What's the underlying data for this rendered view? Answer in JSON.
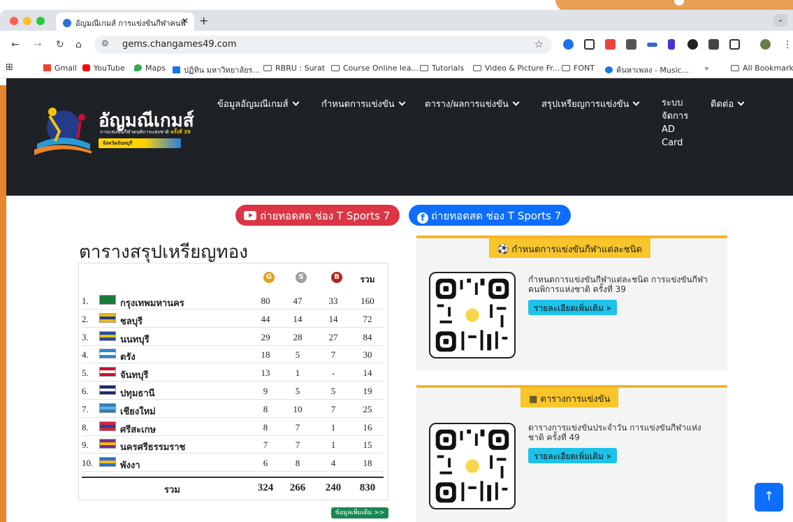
{
  "browser": {
    "tab_title": "อัญมณีเกมส์ การแข่งขันกีฬาคนพิ",
    "url": "gems.changames49.com",
    "bookmarks": [
      {
        "label": "Gmail",
        "icon": "gmail-icon"
      },
      {
        "label": "YouTube",
        "icon": "youtube-icon"
      },
      {
        "label": "Maps",
        "icon": "maps-icon"
      },
      {
        "label": "ปฏิทิน มหาวิทยาลัยร...",
        "icon": "calendar-icon"
      },
      {
        "label": "RBRU : Surat",
        "icon": "folder-icon"
      },
      {
        "label": "Course Online lea...",
        "icon": "folder-icon"
      },
      {
        "label": "Tutorials",
        "icon": "folder-icon"
      },
      {
        "label": "Video & Picture Fr...",
        "icon": "folder-icon"
      },
      {
        "label": "FONT",
        "icon": "folder-icon"
      },
      {
        "label": "ค้นหาเพลง - Music...",
        "icon": "music-icon"
      }
    ],
    "bookmarks_overflow": "»",
    "all_bookmarks": "All Bookmarks"
  },
  "site": {
    "logo_title": "อัญมณีเกมส์",
    "logo_sub": "การแข่งขันกีฬาคนพิการแห่งชาติ",
    "logo_sub_bold": "ครั้งที่ 39",
    "logo_ribbon": "จังหวัดจันทบุรี",
    "nav": [
      {
        "label": "ข้อมูลอัญมณีเกมส์"
      },
      {
        "label": "กำหนดการแข่งขัน"
      },
      {
        "label": "ตาราง/ผลการแข่งขัน"
      },
      {
        "label": "สรุปเหรียญการแข่งขัน"
      },
      {
        "label": "ติดต่อ"
      }
    ],
    "nav_ad": "ระบบ จัดการ AD Card"
  },
  "live": {
    "youtube": "ถ่ายทอดสด ช่อง T Sports 7",
    "facebook": "ถ่ายทอดสด ช่อง T Sports 7"
  },
  "medals": {
    "title": "ตารางสรุปเหรียญทอง",
    "head_g": "G",
    "head_s": "S",
    "head_b": "B",
    "head_total": "รวม",
    "rows": [
      {
        "rank": "1.",
        "name": "กรุงเทพมหานคร",
        "g": "80",
        "s": "47",
        "b": "33",
        "t": "160",
        "flag": [
          "#1a7a3a",
          "#1a7a3a"
        ]
      },
      {
        "rank": "2.",
        "name": "ชลบุรี",
        "g": "44",
        "s": "14",
        "b": "14",
        "t": "72",
        "flag": [
          "#f0b800",
          "#1d3e99"
        ]
      },
      {
        "rank": "3.",
        "name": "นนทบุรี",
        "g": "29",
        "s": "28",
        "b": "27",
        "t": "84",
        "flag": [
          "#1f4da6",
          "#f2c200"
        ]
      },
      {
        "rank": "4.",
        "name": "ตรัง",
        "g": "18",
        "s": "5",
        "b": "7",
        "t": "30",
        "flag": [
          "#2c86d6",
          "#ffffff"
        ]
      },
      {
        "rank": "5.",
        "name": "จันทบุรี",
        "g": "13",
        "s": "1",
        "b": "-",
        "t": "14",
        "flag": [
          "#c8102e",
          "#ffffff"
        ]
      },
      {
        "rank": "6.",
        "name": "ปทุมธานี",
        "g": "9",
        "s": "5",
        "b": "5",
        "t": "19",
        "flag": [
          "#1a2a6c",
          "#ffffff"
        ]
      },
      {
        "rank": "7.",
        "name": "เชียงใหม่",
        "g": "8",
        "s": "10",
        "b": "7",
        "t": "25",
        "flag": [
          "#2c7fb8",
          "#6ab0e0"
        ]
      },
      {
        "rank": "8.",
        "name": "ศรีสะเกษ",
        "g": "8",
        "s": "7",
        "b": "1",
        "t": "16",
        "flag": [
          "#d0263b",
          "#2a3f9a"
        ]
      },
      {
        "rank": "9.",
        "name": "นครศรีธรรมราช",
        "g": "7",
        "s": "7",
        "b": "1",
        "t": "15",
        "flag": [
          "#7a2b9a",
          "#f2c200"
        ]
      },
      {
        "rank": "10.",
        "name": "พังงา",
        "g": "6",
        "s": "8",
        "b": "4",
        "t": "18",
        "flag": [
          "#2a6fd1",
          "#f2c200"
        ]
      }
    ],
    "total_label": "รวม",
    "total_g": "324",
    "total_s": "266",
    "total_b": "240",
    "total_t": "830",
    "more": "ข้อมูลเพิ่มเติม >>"
  },
  "cards": [
    {
      "tag": "กำหนดการแข่งขันกีฬาแต่ละชนิด",
      "text": "กำหนดการแข่งขันกีฬาแต่ละชนิด การแข่งขันกีฬาคนพิการแห่งชาติ ครั้งที่ 39",
      "button": "รายละเอียดเพิ่มเติม"
    },
    {
      "tag": "ตารางการแข่งขัน",
      "text": "ตารางการแข่งขันประจำวัน การแข่งขันกีฬาแห่งชาติ ครั้งที่ 49",
      "button": "รายละเอียดเพิ่มเติม"
    }
  ],
  "colors": {
    "gold": "#e6a017",
    "silver": "#9aa0a6",
    "bronze": "#b3261e",
    "header_bg": "#1e2125",
    "card_accent": "#f5b523"
  }
}
